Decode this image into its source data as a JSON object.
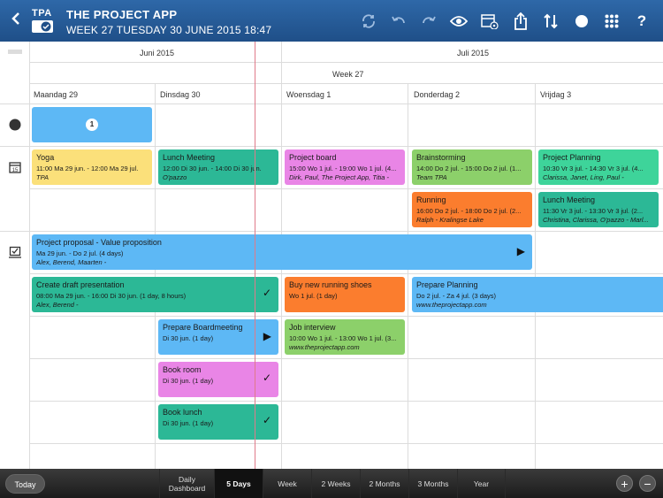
{
  "header": {
    "logo_text": "TPA",
    "app_title": "THE PROJECT APP",
    "subtitle": "WEEK 27  TUESDAY 30 JUNE 2015  18:47",
    "icons": [
      "back-icon",
      "sync-icon",
      "undo-icon",
      "redo-icon",
      "eye-icon",
      "calendar-view-icon",
      "share-icon",
      "sort-icon",
      "circle-icon",
      "apps-grid-icon",
      "help-icon"
    ]
  },
  "calendar": {
    "months": [
      "Juni 2015",
      "Juli 2015"
    ],
    "week_label": "Week 27",
    "days": [
      "Maandag 29",
      "Dinsdag 30",
      "Woensdag 1",
      "Donderdag 2",
      "Vrijdag 3"
    ]
  },
  "events": [
    {
      "title": "",
      "badge": "1",
      "color": "#5db8f5"
    },
    {
      "title": "Yoga",
      "time": "11:00 Ma 29 jun. - 12:00 Ma 29 jul.",
      "people": "TPA",
      "color": "#fbe07a"
    },
    {
      "title": "Lunch Meeting",
      "time": "12:00 Di 30 jun. - 14:00 Di 30 jun.",
      "people": "O'pazzo",
      "color": "#2cb896"
    },
    {
      "title": "Project board",
      "time": "15:00 Wo 1 jul. - 19:00 Wo 1 jul. (4...",
      "people": "Dirk, Paul, The Project App, Titia -",
      "color": "#e985e6"
    },
    {
      "title": "Brainstorming",
      "time": "14:00 Do 2 jul. - 15:00 Do 2 jul. (1...",
      "people": "Team TPA",
      "color": "#8cd06a"
    },
    {
      "title": "Project Planning",
      "time": "10:30 Vr 3 jul. - 14:30 Vr 3 jul. (4...",
      "people": "Clarissa, Janet, Ling, Paul -",
      "color": "#3ed49a"
    },
    {
      "title": "Running",
      "time": "16:00 Do 2 jul. - 18:00 Do 2 jul. (2...",
      "people": "Ralph - Kralingse Lake",
      "color": "#fb7d2e"
    },
    {
      "title": "Lunch Meeting",
      "time": "11:30 Vr 3 jul. - 13:30 Vr 3 jul. (2...",
      "people": "Christina, Clarissa, O'pazzo - Marl...",
      "color": "#2cb896"
    }
  ],
  "tasks": [
    {
      "title": "Project proposal - Value proposition",
      "time": "Ma 29 jun. - Do 2 jul. (4 days)",
      "people": "Alex, Berend, Maarten -",
      "marker": "▶",
      "color": "#5db8f5"
    },
    {
      "title": "Create draft presentation",
      "time": "08:00 Ma 29 jun. - 16:00 Di 30 jun. (1 day, 8 hours)",
      "people": "Alex, Berend -",
      "marker": "✓",
      "color": "#2cb896"
    },
    {
      "title": "Buy new running shoes",
      "time": "Wo 1 jul. (1 day)",
      "people": "",
      "marker": "",
      "color": "#fb7d2e"
    },
    {
      "title": "Prepare Planning",
      "time": "Do 2 jul. - Za 4 jul. (3 days)",
      "people": "www.theprojectapp.com",
      "marker": "",
      "color": "#5db8f5"
    },
    {
      "title": "Prepare Boardmeeting",
      "time": "Di 30 jun. (1 day)",
      "people": "",
      "marker": "▶",
      "color": "#5db8f5"
    },
    {
      "title": "Job interview",
      "time": "10:00 Wo 1 jul. - 13:00 Wo 1 jul. (3...",
      "people": "www.theprojectapp.com",
      "marker": "",
      "color": "#8cd06a"
    },
    {
      "title": "Book room",
      "time": "Di 30 jun. (1 day)",
      "people": "",
      "marker": "✓",
      "color": "#e985e6"
    },
    {
      "title": "Book lunch",
      "time": "Di 30 jun. (1 day)",
      "people": "",
      "marker": "✓",
      "color": "#2cb896"
    }
  ],
  "toolbar": {
    "today": "Today",
    "tabs": [
      "Daily Dashboard",
      "5 Days",
      "Week",
      "2 Weeks",
      "2 Months",
      "3 Months",
      "Year"
    ],
    "active_tab": "5 Days",
    "zoom_in": "+",
    "zoom_out": "−"
  }
}
